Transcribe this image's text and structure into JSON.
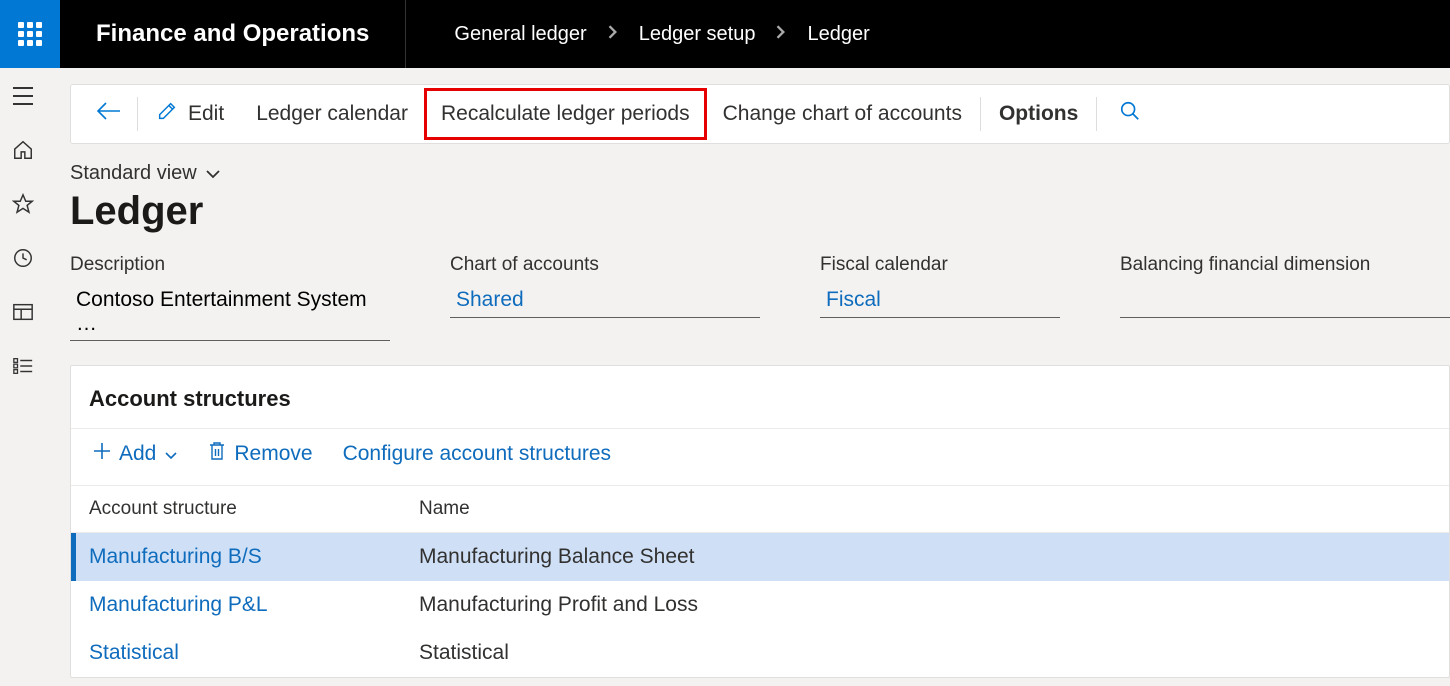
{
  "header": {
    "app_title": "Finance and Operations",
    "breadcrumbs": [
      "General ledger",
      "Ledger setup",
      "Ledger"
    ]
  },
  "action_pane": {
    "edit": "Edit",
    "ledger_calendar": "Ledger calendar",
    "recalculate": "Recalculate ledger periods",
    "change_coa": "Change chart of accounts",
    "options": "Options"
  },
  "view": {
    "selector": "Standard view",
    "page_title": "Ledger"
  },
  "fields": {
    "description_label": "Description",
    "description_value": "Contoso Entertainment System …",
    "coa_label": "Chart of accounts",
    "coa_value": "Shared",
    "fiscal_label": "Fiscal calendar",
    "fiscal_value": "Fiscal",
    "balancing_label": "Balancing financial dimension",
    "balancing_value": ""
  },
  "account_structures": {
    "title": "Account structures",
    "toolbar": {
      "add": "Add",
      "remove": "Remove",
      "configure": "Configure account structures"
    },
    "columns": [
      "Account structure",
      "Name"
    ],
    "rows": [
      {
        "structure": "Manufacturing B/S",
        "name": "Manufacturing Balance Sheet",
        "selected": true
      },
      {
        "structure": "Manufacturing P&L",
        "name": "Manufacturing Profit and Loss",
        "selected": false
      },
      {
        "structure": "Statistical",
        "name": "Statistical",
        "selected": false
      }
    ]
  }
}
